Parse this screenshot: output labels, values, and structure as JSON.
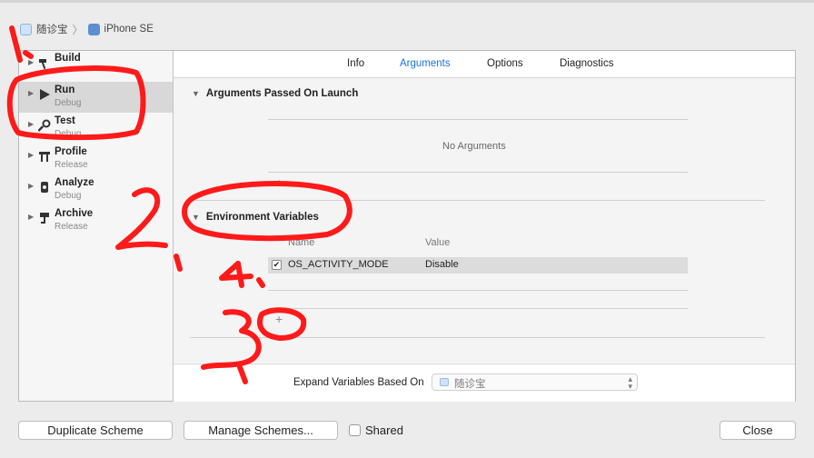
{
  "breadcrumb": {
    "project": "随诊宝",
    "device": "iPhone SE"
  },
  "sidebar": {
    "items": [
      {
        "name": "Build",
        "sub": "",
        "icon": "hammer-icon"
      },
      {
        "name": "Run",
        "sub": "Debug",
        "icon": "play-icon",
        "selected": true
      },
      {
        "name": "Test",
        "sub": "Debug",
        "icon": "wrench-icon"
      },
      {
        "name": "Profile",
        "sub": "Release",
        "icon": "instruments-icon"
      },
      {
        "name": "Analyze",
        "sub": "Debug",
        "icon": "analyze-icon"
      },
      {
        "name": "Archive",
        "sub": "Release",
        "icon": "archive-icon"
      }
    ]
  },
  "tabs": [
    "Info",
    "Arguments",
    "Options",
    "Diagnostics"
  ],
  "active_tab": "Arguments",
  "arguments": {
    "title": "Arguments Passed On Launch",
    "empty_text": "No Arguments"
  },
  "environment": {
    "title": "Environment Variables",
    "columns": [
      "Name",
      "Value"
    ],
    "rows": [
      {
        "checked": true,
        "name": "OS_ACTIVITY_MODE",
        "value": "Disable"
      }
    ]
  },
  "footer": {
    "label": "Expand Variables Based On",
    "selected": "随诊宝"
  },
  "buttons": {
    "duplicate": "Duplicate Scheme",
    "manage": "Manage Schemes...",
    "shared": "Shared",
    "close": "Close"
  },
  "annotation_color": "#ff1a1a",
  "accent_color": "#1a73d9"
}
